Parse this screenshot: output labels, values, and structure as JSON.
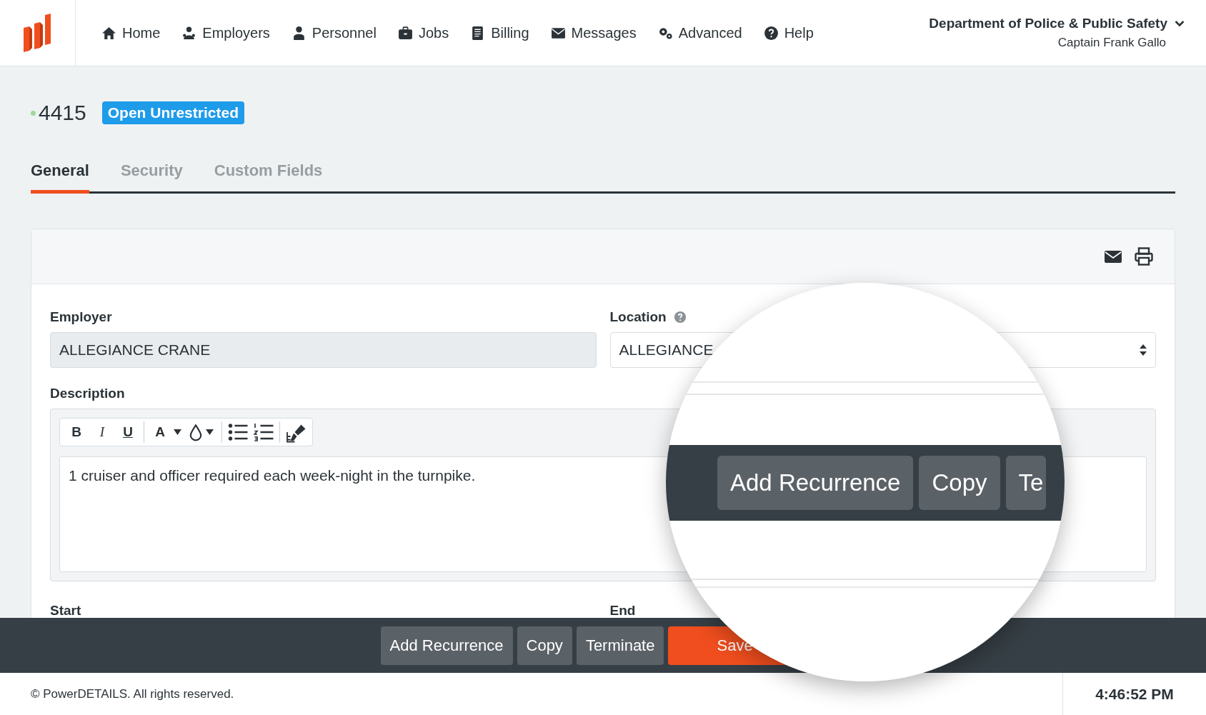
{
  "nav": {
    "items": [
      {
        "label": "Home"
      },
      {
        "label": "Employers"
      },
      {
        "label": "Personnel"
      },
      {
        "label": "Jobs"
      },
      {
        "label": "Billing"
      },
      {
        "label": "Messages"
      },
      {
        "label": "Advanced"
      },
      {
        "label": "Help"
      }
    ],
    "account": {
      "organization": "Department of Police & Public Safety",
      "user": "Captain Frank Gallo"
    }
  },
  "record": {
    "number": "4415",
    "status": "Open Unrestricted"
  },
  "tabs": [
    {
      "label": "General",
      "selected": true
    },
    {
      "label": "Security",
      "selected": false
    },
    {
      "label": "Custom Fields",
      "selected": false
    }
  ],
  "form": {
    "employer": {
      "label": "Employer",
      "value": "ALLEGIANCE CRANE",
      "disabled": true
    },
    "location": {
      "label": "Location",
      "value": "ALLEGIANCE"
    },
    "description": {
      "label": "Description",
      "toolbar": [
        "B",
        "I",
        "U",
        "A"
      ],
      "value": "1 cruiser and officer required each week-night in the turnpike."
    },
    "start": {
      "label": "Start"
    },
    "end": {
      "label": "End"
    }
  },
  "actions": [
    {
      "label": "Add Recurrence",
      "kind": "secondary"
    },
    {
      "label": "Copy",
      "kind": "secondary"
    },
    {
      "label": "Terminate",
      "kind": "secondary"
    },
    {
      "label": "Save",
      "kind": "primary"
    }
  ],
  "magnifier": {
    "actions": [
      {
        "label": "Add Recurrence"
      },
      {
        "label": "Copy"
      },
      {
        "label": "Te"
      }
    ]
  },
  "footer": {
    "copyright": "© PowerDETAILS. All rights reserved.",
    "time": "4:46:52 PM"
  }
}
